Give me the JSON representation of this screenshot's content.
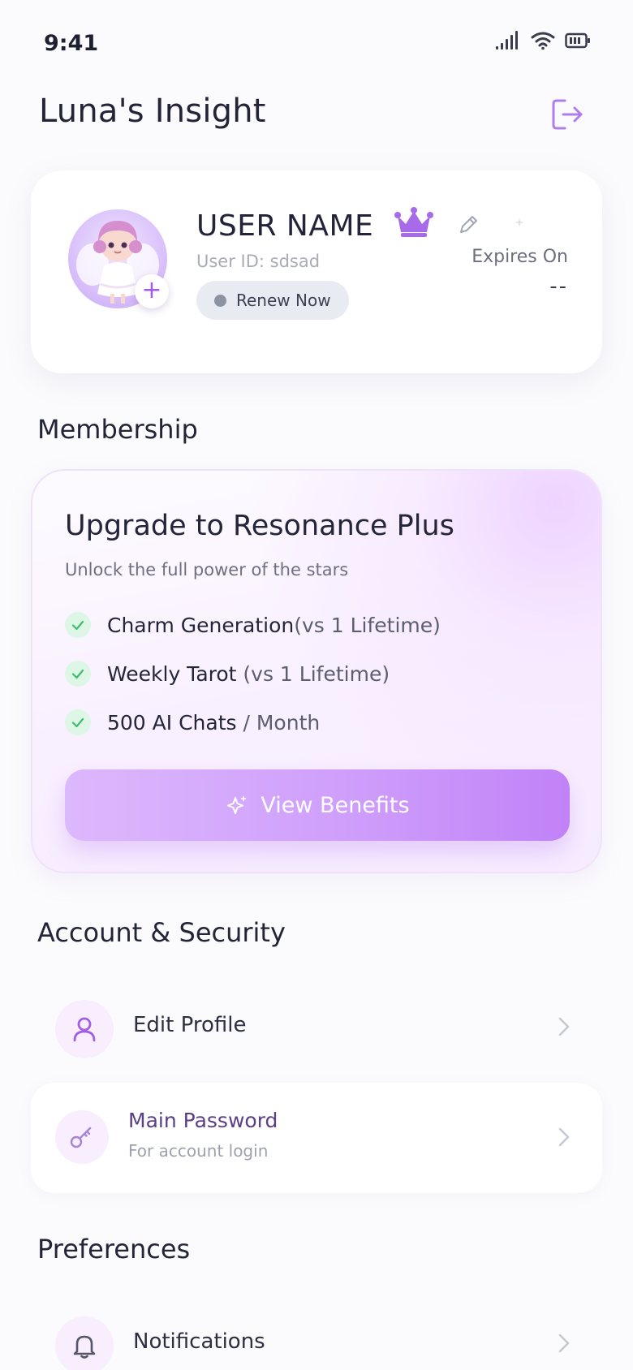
{
  "status_bar": {
    "time": "9:41"
  },
  "header": {
    "title": "Luna's Insight"
  },
  "profile": {
    "user_name": "USER NAME",
    "user_id": "User ID: sdsad",
    "renew_label": "Renew Now",
    "expires_label": "Expires On",
    "expires_value": "--"
  },
  "membership": {
    "section_title": "Membership",
    "title": "Upgrade to Resonance Plus",
    "subtitle": "Unlock the full power of the stars",
    "features": [
      {
        "bold": "Charm Generation",
        "muted": "(vs 1 Lifetime)"
      },
      {
        "bold": "Weekly Tarot",
        "muted": " (vs 1 Lifetime)"
      },
      {
        "bold": "500 AI Chats",
        "muted": " / Month"
      }
    ],
    "button_label": "View Benefits"
  },
  "account": {
    "section_title": "Account & Security",
    "items": [
      {
        "label": "Edit Profile",
        "icon": "user-icon"
      },
      {
        "label": "Main Password",
        "sublabel": "For account login",
        "icon": "key-icon"
      }
    ]
  },
  "preferences": {
    "section_title": "Preferences",
    "items": [
      {
        "label": "Notifications",
        "icon": "bell-icon"
      }
    ]
  },
  "colors": {
    "accent": "#b46ef0",
    "button_gradient_start": "#dcb8fd",
    "button_gradient_end": "#c182f7",
    "check_bg": "#ddf6e6",
    "check_color": "#3dbd6d"
  }
}
